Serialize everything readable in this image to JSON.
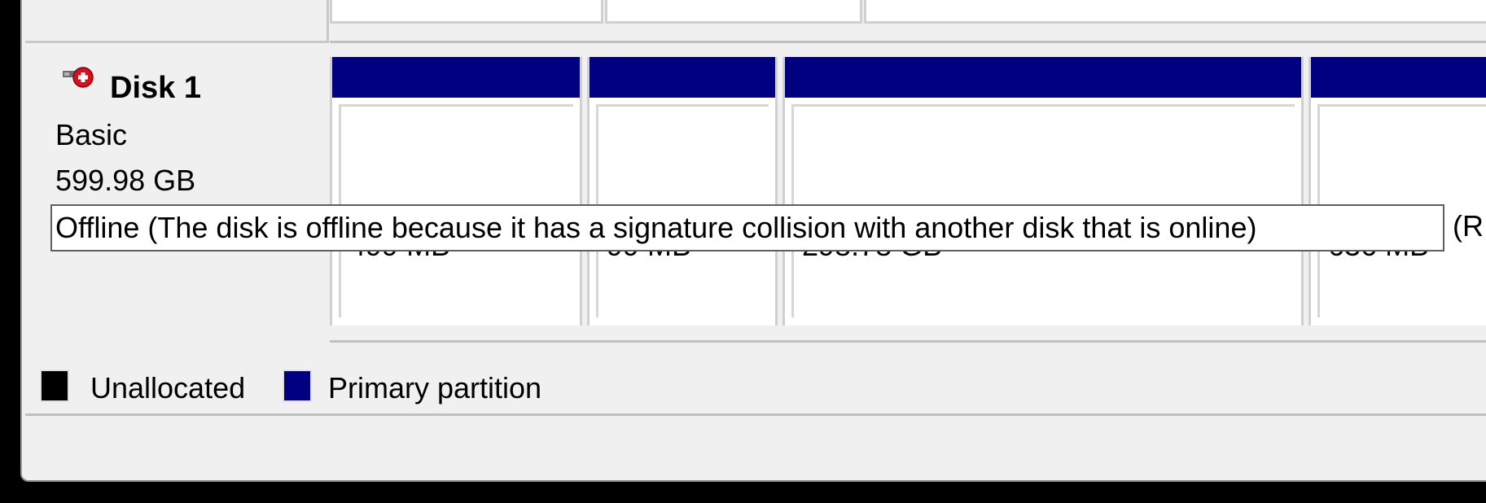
{
  "disk": {
    "title": "Disk 1",
    "type": "Basic",
    "size": "599.98 GB",
    "status_icon": "disk-offline-icon",
    "tooltip": "Offline (The disk is offline because it has a signature collision with another disk that is online)",
    "tooltip_overflow": "(R"
  },
  "partitions": [
    {
      "size": "499 MB",
      "kind": "Primary partition"
    },
    {
      "size": "99 MB",
      "kind": "Primary partition"
    },
    {
      "size": "298.78 GB",
      "kind": "Primary partition"
    },
    {
      "size": "636 MB",
      "kind": "Primary partition"
    }
  ],
  "legend": [
    {
      "label": "Unallocated",
      "color": "#000000"
    },
    {
      "label": "Primary partition",
      "color": "#000080"
    }
  ],
  "colors": {
    "primary_partition": "#000080",
    "unallocated": "#000000",
    "window_bg": "#f0f0f0"
  }
}
